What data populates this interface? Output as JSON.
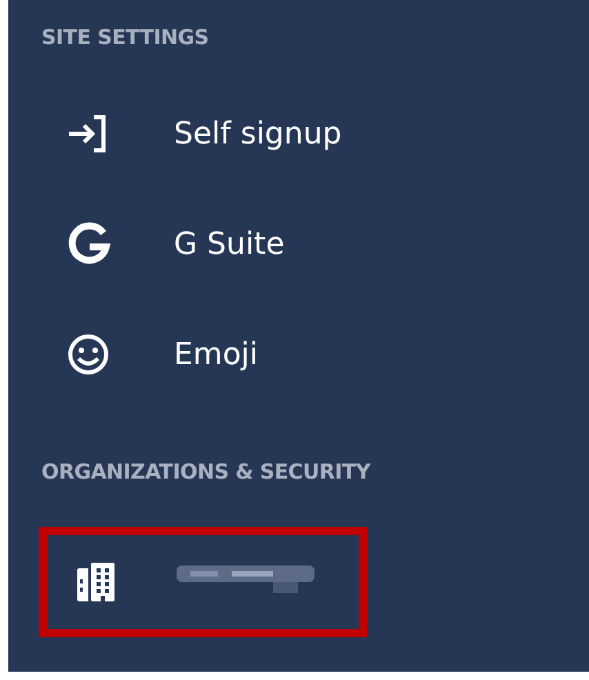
{
  "sections": [
    {
      "heading": "SITE SETTINGS",
      "items": [
        {
          "kind": "signin",
          "label": "Self signup",
          "highlighted": false
        },
        {
          "kind": "google",
          "label": "G Suite",
          "highlighted": false
        },
        {
          "kind": "emoji",
          "label": "Emoji",
          "highlighted": false
        }
      ]
    },
    {
      "heading": "ORGANIZATIONS & SECURITY",
      "items": [
        {
          "kind": "building",
          "redacted": true,
          "highlighted": true
        }
      ]
    }
  ]
}
